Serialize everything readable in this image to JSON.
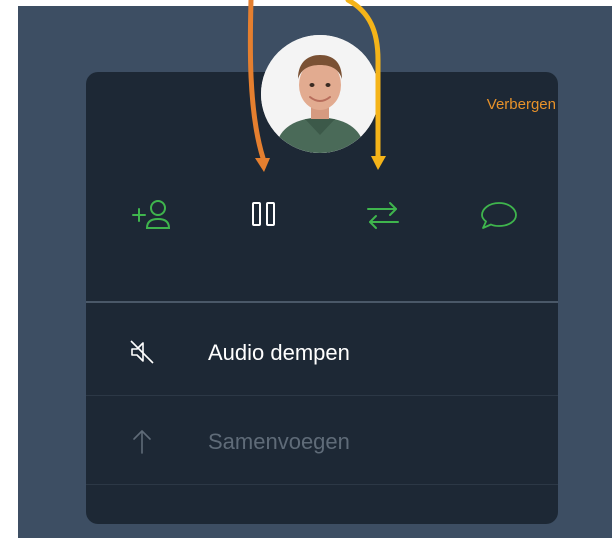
{
  "call_panel": {
    "hide_label": "Verbergen",
    "controls": [
      {
        "icon": "add-contact-icon"
      },
      {
        "icon": "pause-icon"
      },
      {
        "icon": "transfer-icon"
      },
      {
        "icon": "chat-bubble-icon"
      }
    ],
    "menu": [
      {
        "label": "Audio dempen",
        "icon": "mute-speaker-icon",
        "enabled": true
      },
      {
        "label": "Samenvoegen",
        "icon": "merge-arrow-icon",
        "enabled": false
      }
    ]
  },
  "colors": {
    "background": "#3d4e63",
    "panel": "#1d2835",
    "accent_green": "#3fb54d",
    "accent_orange": "#e8922a",
    "arrow_orange": "#e57f2f",
    "arrow_yellow": "#f5b419",
    "text_primary": "#ffffff",
    "text_disabled": "#5f6b78"
  }
}
